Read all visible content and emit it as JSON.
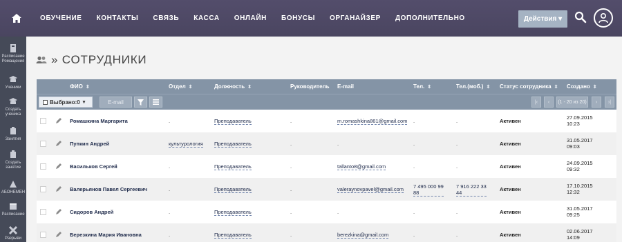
{
  "nav": {
    "items": [
      "ОБУЧЕНИЕ",
      "КОНТАКТЫ",
      "СВЯЗЬ",
      "КАССА",
      "ОНЛАЙН",
      "БОНУСЫ",
      "ОРГАНАЙЗЕР",
      "ДОПОЛНИТЕЛЬНО"
    ],
    "actions_label": "Действия ▾",
    "home_icon": "home-icon",
    "search_icon": "search-icon",
    "user_icon": "user-icon"
  },
  "sidebar": {
    "items": [
      {
        "label": "Расписание\nРомащения",
        "icon": "schedule-icon"
      },
      {
        "label": "Ученики",
        "icon": "students-icon"
      },
      {
        "label": "Создать\nученика",
        "icon": "add-student-icon"
      },
      {
        "label": "Занятия",
        "icon": "lessons-icon"
      },
      {
        "label": "Создать\nзанятие",
        "icon": "add-lesson-icon"
      },
      {
        "label": "АБОНЕМЕН",
        "icon": "subscription-icon"
      },
      {
        "label": "Расписание",
        "icon": "calendar-icon"
      },
      {
        "label": "Разрыви",
        "icon": "breaks-icon"
      }
    ]
  },
  "page": {
    "title": "» СОТРУДНИКИ",
    "title_icon": "users-icon"
  },
  "table": {
    "headers": {
      "fio": "ФИО",
      "dept": "Отдел",
      "position": "Должность",
      "manager": "Руководитель",
      "email": "E-mail",
      "phone": "Тел.",
      "mobile": "Тел.(моб.)",
      "status": "Статус сотрудника",
      "created": "Создано"
    },
    "toolbar": {
      "selected_label": "Выбрано:0",
      "email_label": "E-mail",
      "pagination": "(1 - 20 из 20)",
      "first": "|‹",
      "prev": "‹",
      "next": "›",
      "last": "›|"
    },
    "rows": [
      {
        "name": "Ромашкина Маргарита",
        "dept": ".",
        "position": "Преподаватель",
        "manager": ".",
        "email": "m.romashkina861@gmail.com",
        "phone": ".",
        "mobile": ".",
        "status": "Активен",
        "created_date": "27.09.2015",
        "created_time": "10:23"
      },
      {
        "name": "Пупкин Андрей",
        "dept": "культурология",
        "position": "Преподаватель",
        "manager": ".",
        "email": ".",
        "phone": ".",
        "mobile": ".",
        "status": "Активен",
        "created_date": "31.05.2017",
        "created_time": "09:03"
      },
      {
        "name": "Васильков Сергей",
        "dept": ".",
        "position": "Преподаватель",
        "manager": ".",
        "email": "tallanto8@gmail.com",
        "phone": ".",
        "mobile": ".",
        "status": "Активен",
        "created_date": "24.09.2015",
        "created_time": "09:32"
      },
      {
        "name": "Валерьянов Павел Сергеевич",
        "dept": ".",
        "position": "Преподаватель",
        "manager": ".",
        "email": "valeraynovpavel@gmail.com",
        "phone": "7 495 000 99 88",
        "mobile": "7 916 222 33 44",
        "status": "Активен",
        "created_date": "17.10.2015",
        "created_time": "12:32"
      },
      {
        "name": "Сидоров Андрей",
        "dept": ".",
        "position": "Преподаватель",
        "manager": ".",
        "email": ".",
        "phone": ".",
        "mobile": ".",
        "status": "Активен",
        "created_date": "31.05.2017",
        "created_time": "09:25"
      },
      {
        "name": "Березкина Мария Ивановна",
        "dept": ".",
        "position": "Преподаватель",
        "manager": ".",
        "email": "berezkina@gmail.com",
        "phone": ".",
        "mobile": ".",
        "status": "Активен",
        "created_date": "02.06.2017",
        "created_time": "14:09"
      }
    ]
  },
  "colors": {
    "topbar": "#4f4a66",
    "sidebar": "#454a58",
    "table_header": "#8494a6",
    "actions_button": "#a5b3c3"
  }
}
